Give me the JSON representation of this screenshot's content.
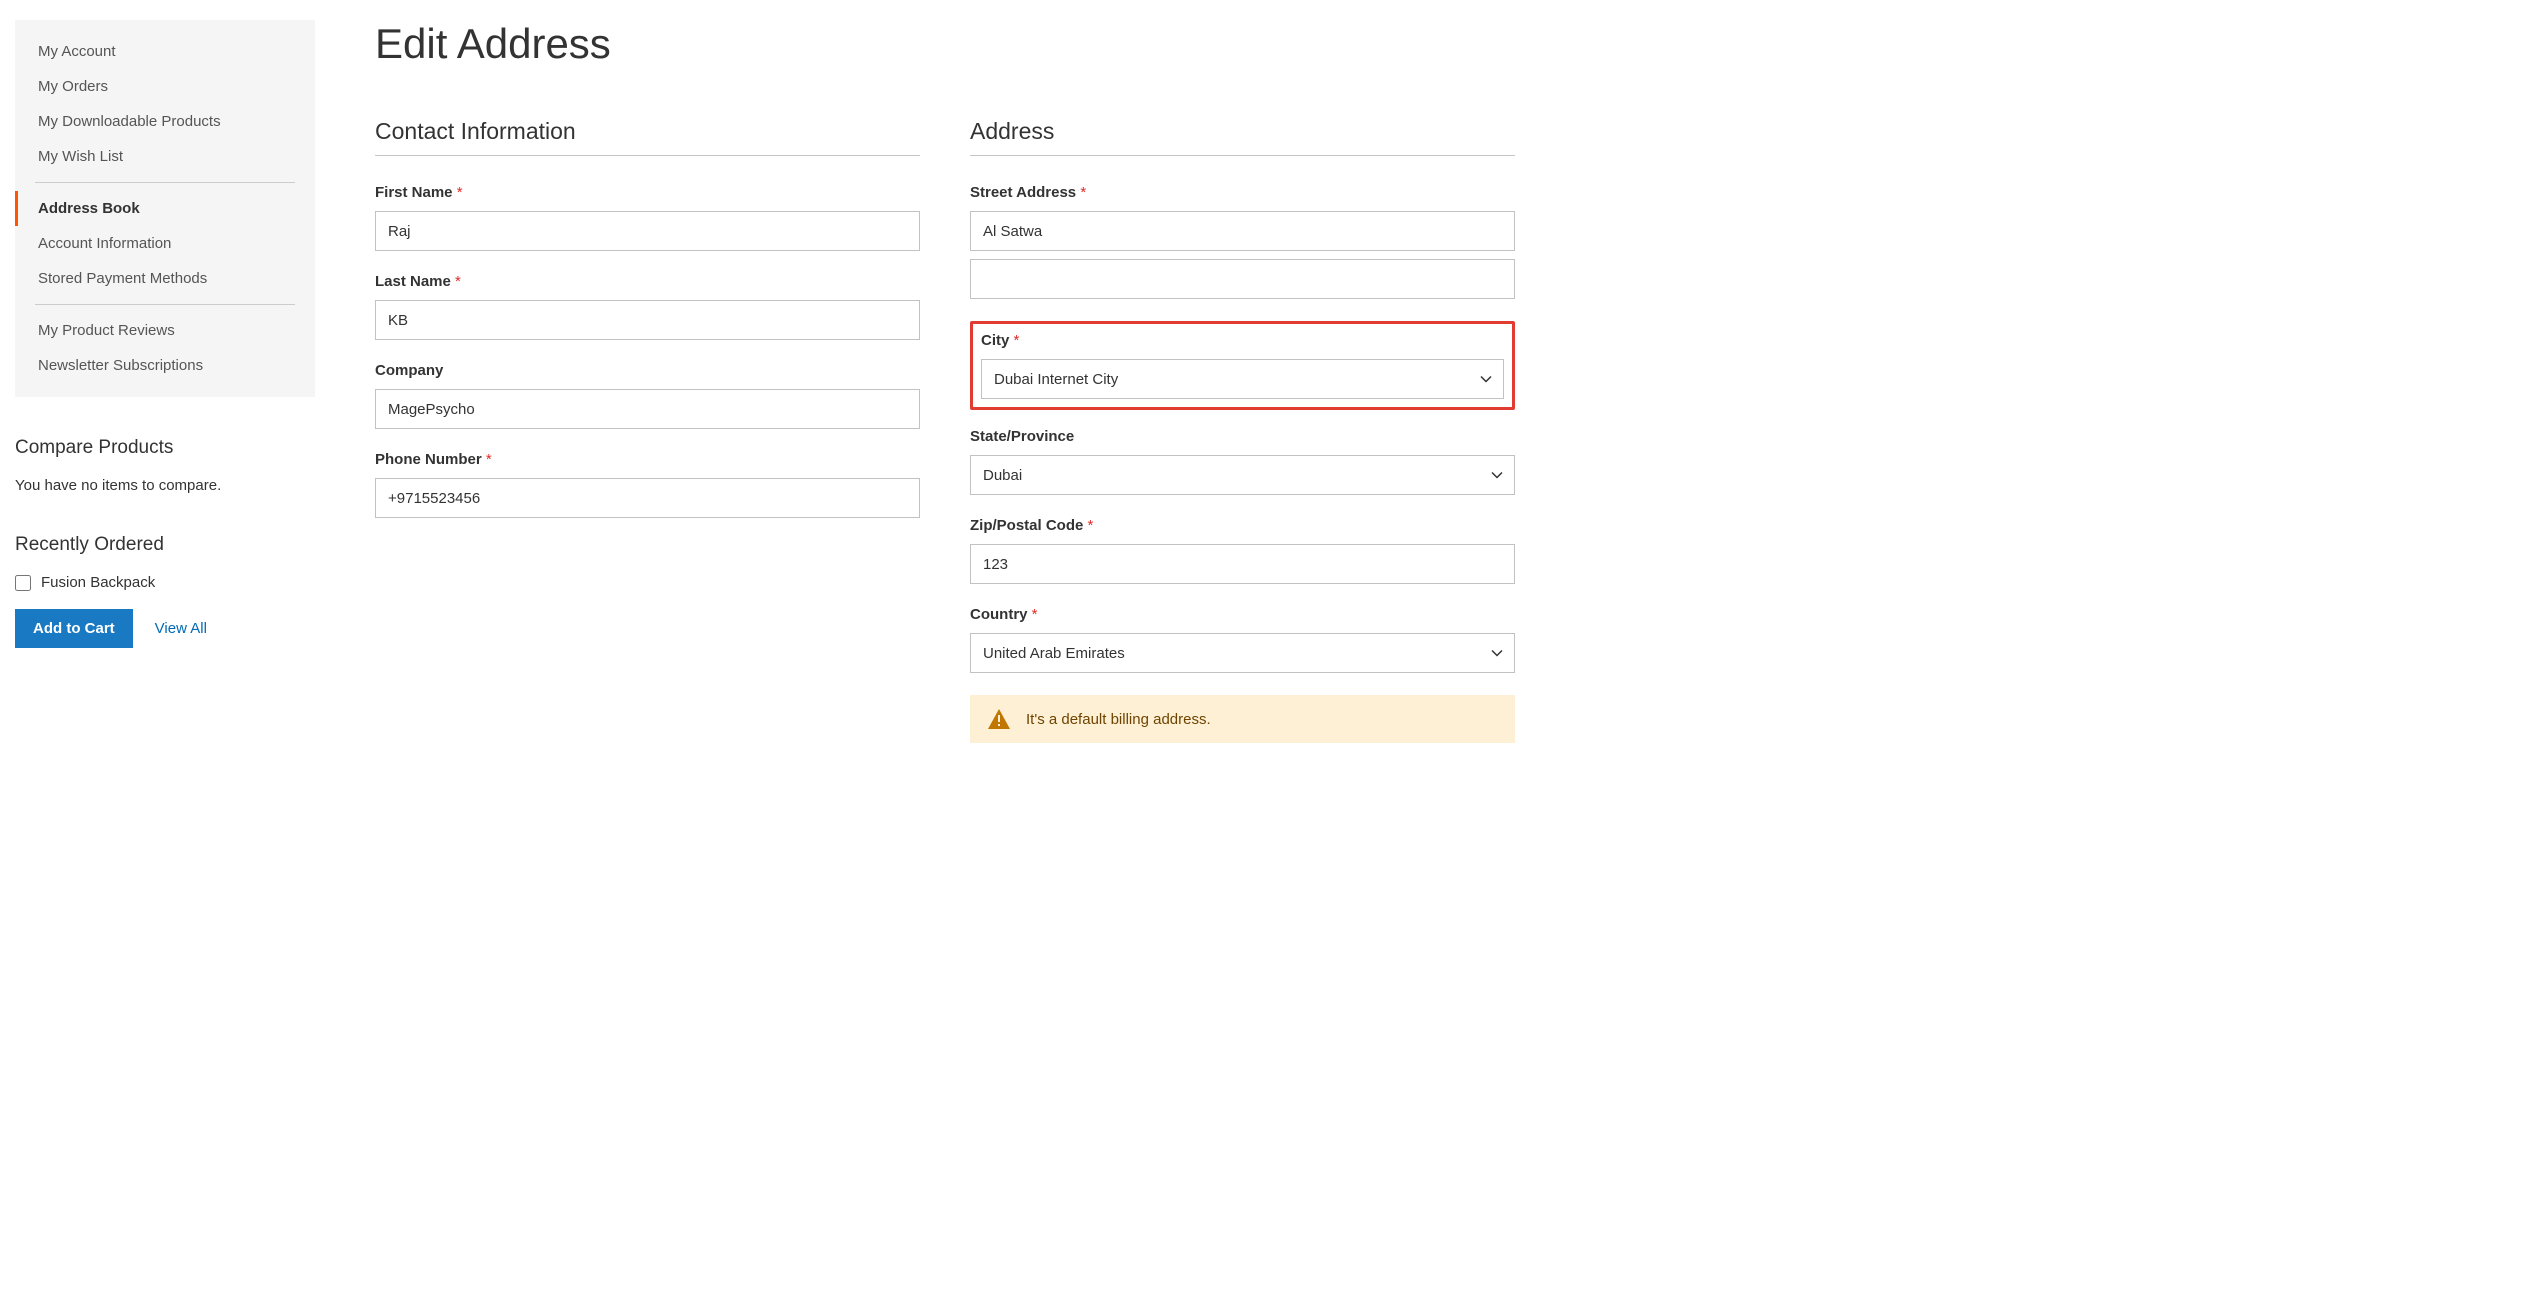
{
  "sidebar": {
    "nav": [
      {
        "label": "My Account"
      },
      {
        "label": "My Orders"
      },
      {
        "label": "My Downloadable Products"
      },
      {
        "label": "My Wish List"
      },
      {
        "label": "Address Book"
      },
      {
        "label": "Account Information"
      },
      {
        "label": "Stored Payment Methods"
      },
      {
        "label": "My Product Reviews"
      },
      {
        "label": "Newsletter Subscriptions"
      }
    ],
    "compare": {
      "title": "Compare Products",
      "empty": "You have no items to compare."
    },
    "recent": {
      "title": "Recently Ordered",
      "item": "Fusion Backpack",
      "add_to_cart": "Add to Cart",
      "view_all": "View All"
    }
  },
  "page": {
    "title": "Edit Address"
  },
  "contact": {
    "section": "Contact Information",
    "first_name_label": "First Name",
    "first_name": "Raj",
    "last_name_label": "Last Name",
    "last_name": "KB",
    "company_label": "Company",
    "company": "MagePsycho",
    "phone_label": "Phone Number",
    "phone": "+9715523456"
  },
  "address": {
    "section": "Address",
    "street_label": "Street Address",
    "street1": "Al Satwa",
    "street2": "",
    "city_label": "City",
    "city": "Dubai Internet City",
    "state_label": "State/Province",
    "state": "Dubai",
    "zip_label": "Zip/Postal Code",
    "zip": "123",
    "country_label": "Country",
    "country": "United Arab Emirates",
    "default_billing": "It's a default billing address."
  }
}
